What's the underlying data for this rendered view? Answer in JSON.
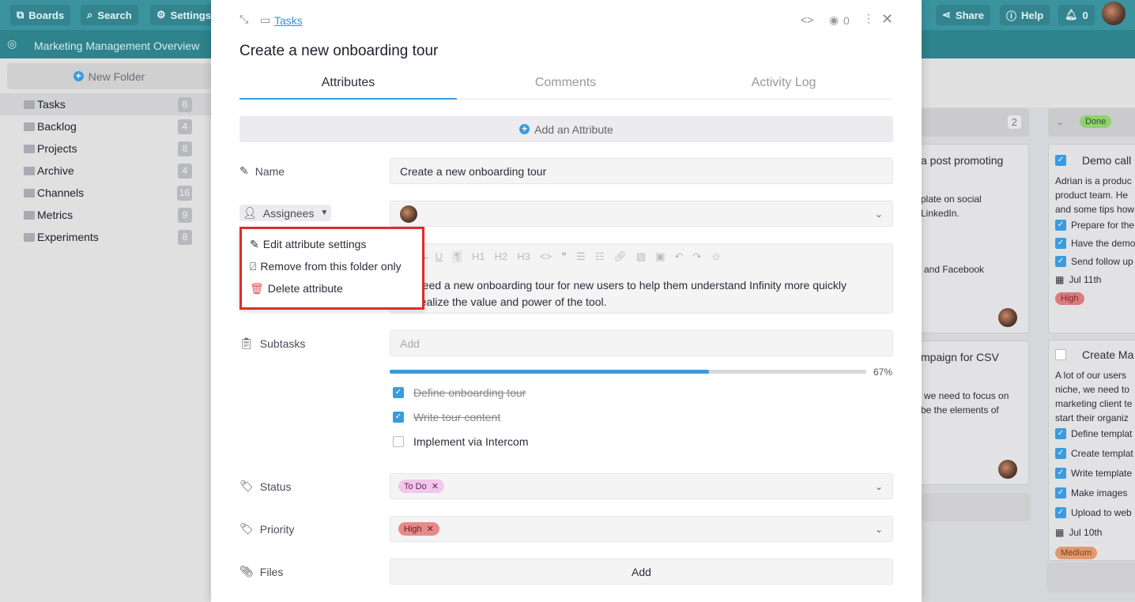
{
  "topbar": {
    "boards": "Boards",
    "search": "Search",
    "settings": "Settings",
    "share": "Share",
    "help": "Help",
    "notifications": "0"
  },
  "board_title": "Marketing Management Overview",
  "sidebar": {
    "new_folder": "New Folder",
    "folders": [
      {
        "label": "Tasks",
        "count": "8"
      },
      {
        "label": "Backlog",
        "count": "4"
      },
      {
        "label": "Projects",
        "count": "8"
      },
      {
        "label": "Archive",
        "count": "4"
      },
      {
        "label": "Channels",
        "count": "16"
      },
      {
        "label": "Metrics",
        "count": "9"
      },
      {
        "label": "Experiments",
        "count": "8"
      }
    ]
  },
  "modal": {
    "breadcrumb": "Tasks",
    "watchers": "0",
    "title": "Create a new onboarding tour",
    "tabs": [
      "Attributes",
      "Comments",
      "Activity Log"
    ],
    "add_attribute": "Add an Attribute",
    "name_label": "Name",
    "name_value": "Create a new onboarding tour",
    "assignees_label": "Assignees",
    "menu": [
      "Edit attribute settings",
      "Remove from this folder only",
      "Delete attribute"
    ],
    "toolbar": [
      "H1",
      "H2",
      "H3"
    ],
    "description": [
      "need a new onboarding tour for new users to help them understand Infinity more quickly",
      "realize the value and power of the tool."
    ],
    "subtasks_label": "Subtasks",
    "subtasks_placeholder": "Add",
    "progress": 67,
    "progress_text": "67%",
    "subtasks": [
      {
        "label": "Define onboarding tour",
        "done": true
      },
      {
        "label": "Write tour content",
        "done": true
      },
      {
        "label": "Implement via Intercom",
        "done": false
      }
    ],
    "status_label": "Status",
    "status_value": "To Do",
    "priority_label": "Priority",
    "priority_value": "High",
    "files_label": "Files",
    "files_add": "Add"
  },
  "board": {
    "col1_count": "2",
    "card1": {
      "title": "a post promoting",
      "lines": [
        "plate on social",
        "LinkedIn.",
        "and Facebook"
      ]
    },
    "card2": {
      "title": "mpaign for CSV",
      "lines": [
        "we need to focus on",
        "be the elements of"
      ]
    },
    "col2_status": "Done",
    "card3": {
      "title": "Demo call",
      "desc": [
        "Adrian is a produc",
        "product team. He",
        "and some tips how"
      ],
      "items": [
        "Prepare for the",
        "Have the demo",
        "Send follow up"
      ],
      "date": "Jul 11th",
      "priority": "High"
    },
    "card4": {
      "title": "Create Ma",
      "desc": [
        "A lot of our users",
        "niche, we need to",
        "marketing client te",
        "start their organiz"
      ],
      "items": [
        "Define templat",
        "Create templat",
        "Write template",
        "Make images",
        "Upload to web"
      ],
      "date": "Jul 10th",
      "priority": "Medium"
    }
  },
  "colors": {
    "teal": "#3a939e",
    "accent": "#3b9be0",
    "highlight": "#e53935",
    "todo": "#f3c6ec",
    "high": "#e88a8a",
    "done": "#8fd16f",
    "medium": "#e09a6e"
  }
}
